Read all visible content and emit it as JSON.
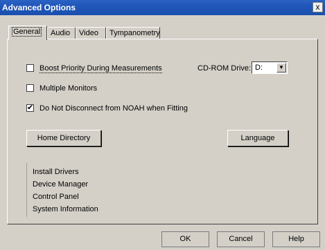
{
  "window": {
    "title": "Advanced Options",
    "close_label": "x"
  },
  "tabs": [
    {
      "label": "General",
      "active": true
    },
    {
      "label": "Audio",
      "active": false
    },
    {
      "label": "Video",
      "active": false
    },
    {
      "label": "Tympanometry",
      "active": false
    }
  ],
  "general": {
    "options": [
      {
        "label": "Boost Priority During Measurements",
        "checked": false
      },
      {
        "label": "Multiple Monitors",
        "checked": false
      },
      {
        "label": "Do Not Disconnect from NOAH when Fitting",
        "checked": true
      }
    ],
    "cdrom": {
      "label": "CD-ROM Drive:",
      "value": "D:"
    },
    "home_directory_label": "Home Directory",
    "language_label": "Language",
    "links": [
      "Install Drivers",
      "Device Manager",
      "Control Panel",
      "System Information"
    ]
  },
  "footer": {
    "ok_label": "OK",
    "cancel_label": "Cancel",
    "help_label": "Help"
  },
  "icons": {
    "check": "check-mark-icon",
    "dropdown": "dropdown-arrow-icon",
    "close": "close-icon"
  }
}
